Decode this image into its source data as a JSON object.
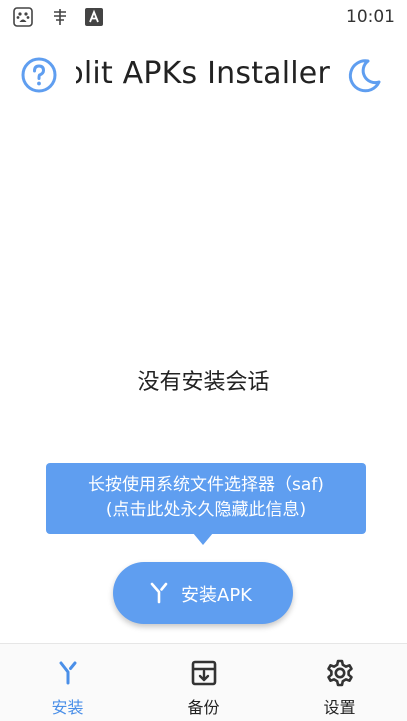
{
  "status_bar": {
    "time": "10:01",
    "icons": [
      "baidu-icon",
      "book-icon",
      "font-a-icon"
    ]
  },
  "app_bar": {
    "title": "Split APKs Installer",
    "help_icon": "help-circle-icon",
    "theme_icon": "moon-icon"
  },
  "main": {
    "empty_message": "没有安装会话"
  },
  "tooltip": {
    "line1": "长按使用系统文件选择器（saf)",
    "line2": "(点击此处永久隐藏此信息)"
  },
  "install_button": {
    "label": "安装APK",
    "icon": "merge-icon"
  },
  "bottom_nav": {
    "items": [
      {
        "label": "安装",
        "icon": "merge-icon",
        "active": true
      },
      {
        "label": "备份",
        "icon": "archive-icon",
        "active": false
      },
      {
        "label": "设置",
        "icon": "gear-icon",
        "active": false
      }
    ]
  },
  "colors": {
    "accent": "#5f9ef0",
    "nav_active": "#4a8fe8",
    "text": "#222222"
  }
}
